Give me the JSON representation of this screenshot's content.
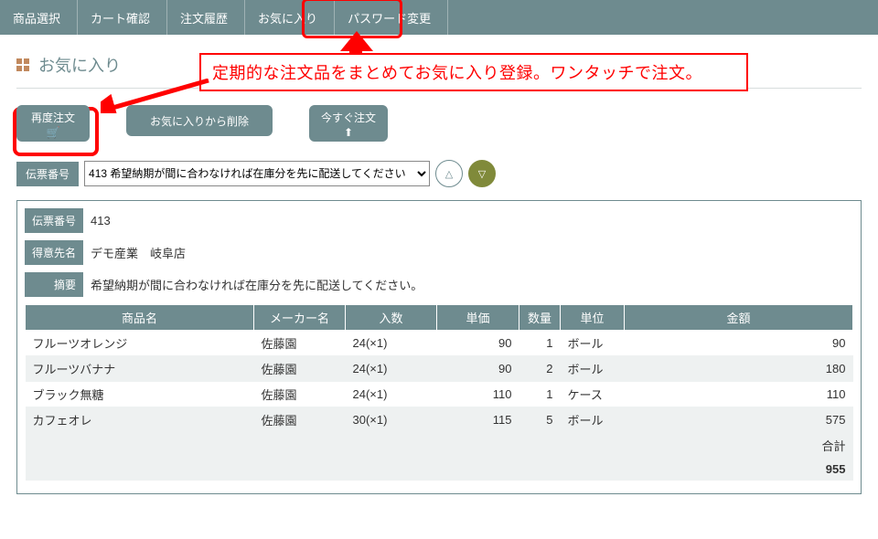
{
  "nav": {
    "items": [
      "商品選択",
      "カート確認",
      "注文履歴",
      "お気に入り",
      "パスワード変更"
    ]
  },
  "annotation": {
    "callout_text": "定期的な注文品をまとめてお気に入り登録。ワンタッチで注文。"
  },
  "title": {
    "icon_name": "grid-icon",
    "text": "お気に入り"
  },
  "actions": {
    "reorder": "再度注文",
    "reorder_icon": "🛒",
    "remove_fav": "お気に入りから削除",
    "order_now": "今すぐ注文",
    "order_now_icon": "⬆"
  },
  "slip": {
    "label": "伝票番号",
    "selected_option": "413 希望納期が間に合わなければ在庫分を先に配送してください",
    "up_icon": "△",
    "down_icon": "▽"
  },
  "detail": {
    "slip_no_label": "伝票番号",
    "slip_no": "413",
    "customer_label": "得意先名",
    "customer": "デモ産業　岐阜店",
    "remarks_label": "摘要",
    "remarks": "希望納期が間に合わなければ在庫分を先に配送してください。"
  },
  "table": {
    "headers": [
      "商品名",
      "メーカー名",
      "入数",
      "単価",
      "数量",
      "単位",
      "金額"
    ],
    "rows": [
      {
        "name": "フルーツオレンジ",
        "maker": "佐藤園",
        "pack": "24(×1)",
        "price": 90,
        "qty": 1,
        "unit": "ボール",
        "amount": 90
      },
      {
        "name": "フルーツバナナ",
        "maker": "佐藤園",
        "pack": "24(×1)",
        "price": 90,
        "qty": 2,
        "unit": "ボール",
        "amount": 180
      },
      {
        "name": "ブラック無糖",
        "maker": "佐藤園",
        "pack": "24(×1)",
        "price": 110,
        "qty": 1,
        "unit": "ケース",
        "amount": 110
      },
      {
        "name": "カフェオレ",
        "maker": "佐藤園",
        "pack": "30(×1)",
        "price": 115,
        "qty": 5,
        "unit": "ボール",
        "amount": 575
      }
    ],
    "total_label": "合計",
    "total_value": 955
  }
}
